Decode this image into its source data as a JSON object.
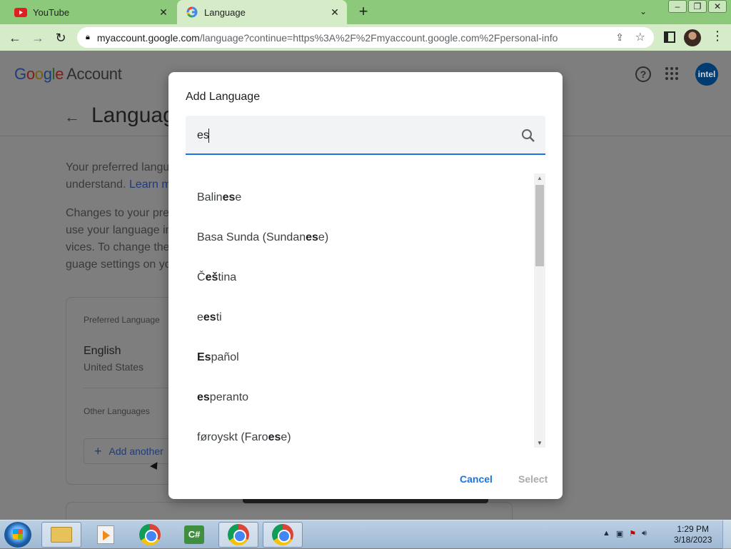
{
  "browser": {
    "tabs": [
      {
        "title": "YouTube",
        "icon": "youtube-icon"
      },
      {
        "title": "Language",
        "icon": "google-icon"
      }
    ],
    "omnibox": {
      "host": "myaccount.google.com",
      "path": "/language?continue=https%3A%2F%2Fmyaccount.google.com%2Fpersonal-info"
    }
  },
  "page": {
    "logo_google": [
      "G",
      "o",
      "o",
      "g",
      "l",
      "e"
    ],
    "logo_account": "Account",
    "avatar_text": "intel",
    "title": "Languag",
    "desc1_line1": "Your preferred langu",
    "desc1_line2": "understand.",
    "desc1_link": "Learn m",
    "desc2_line1": "Changes to your pre",
    "desc2_line2": "use your language in",
    "desc2_line3": "vices. To change the",
    "desc2_line4": "guage settings on yo",
    "preferred_label": "Preferred Language",
    "preferred_lang": "English",
    "preferred_region": "United States",
    "other_label": "Other Languages",
    "add_another": "Add another"
  },
  "modal": {
    "title": "Add Language",
    "search_value": "es",
    "languages": [
      {
        "pre": "Balin",
        "match": "es",
        "post": "e"
      },
      {
        "pre": "Basa Sunda (Sundan",
        "match": "es",
        "post": "e)"
      },
      {
        "pre": "Č",
        "match": "eš",
        "post": "tina"
      },
      {
        "pre": "e",
        "match": "es",
        "post": "ti"
      },
      {
        "pre": "",
        "match": "Es",
        "post": "pañol"
      },
      {
        "pre": "",
        "match": "es",
        "post": "peranto"
      },
      {
        "pre": "føroyskt (Faro",
        "match": "es",
        "post": "e)"
      }
    ],
    "cancel": "Cancel",
    "select": "Select",
    "accent_color": "#1a73e8"
  },
  "taskbar": {
    "time": "1:29 PM",
    "date": "3/18/2023",
    "csharp_label": "C#"
  }
}
